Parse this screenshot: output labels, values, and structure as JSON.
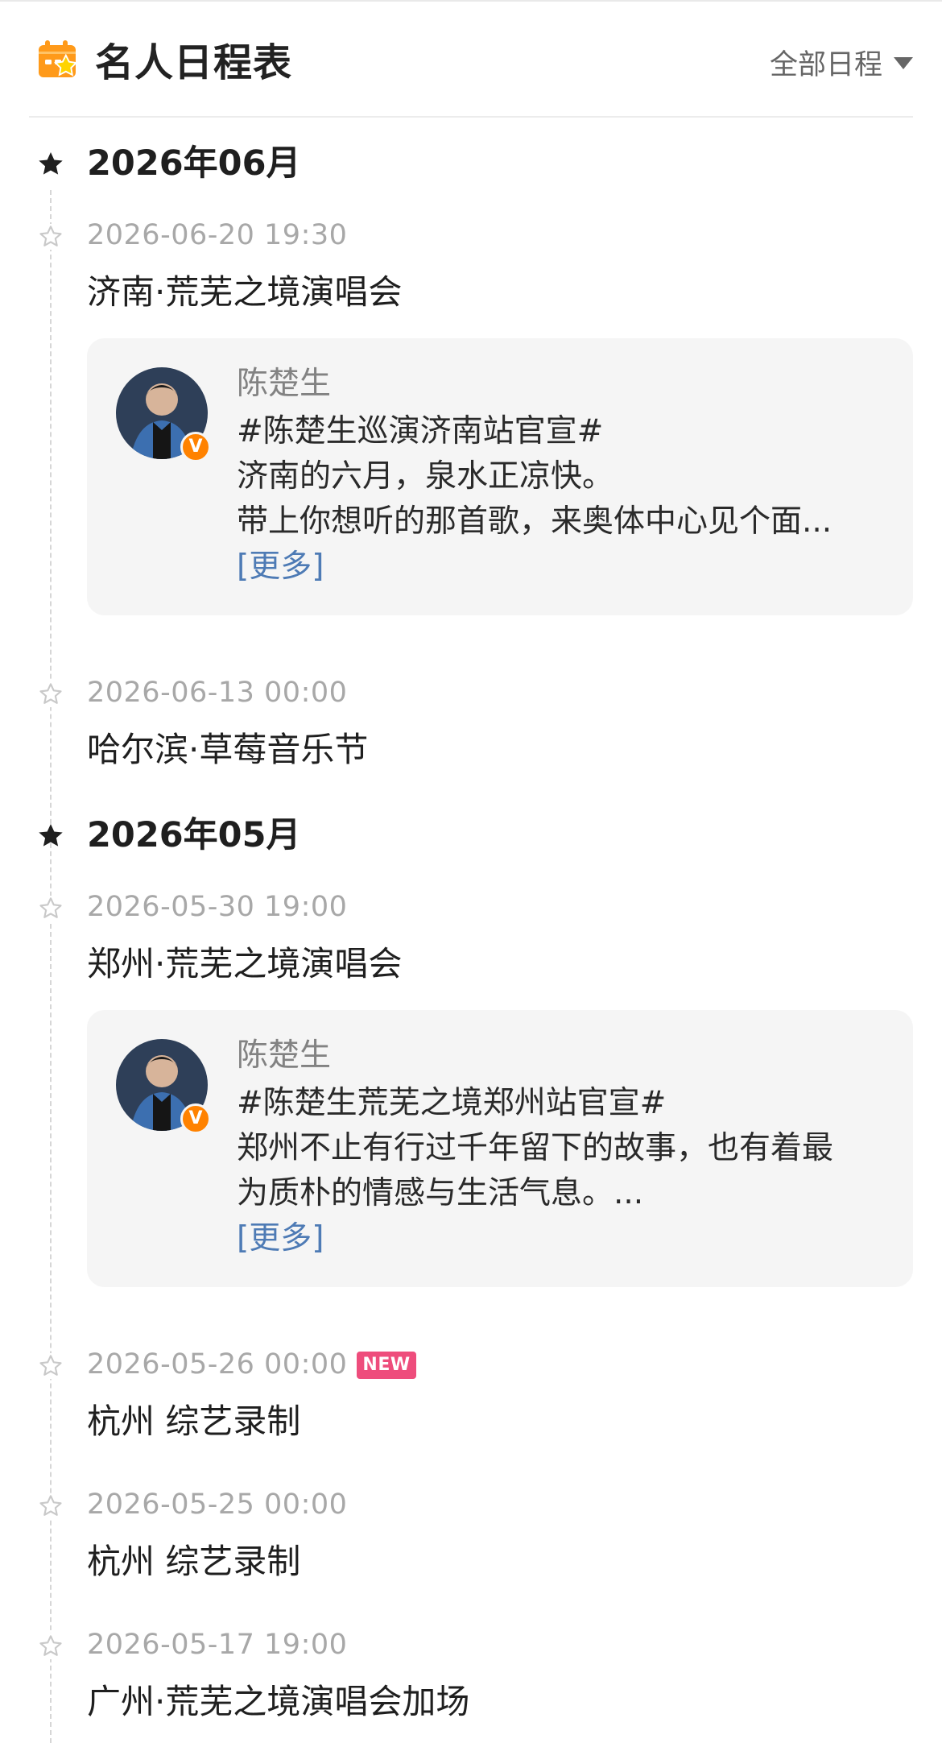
{
  "header": {
    "title": "名人日程表",
    "filter_label": "全部日程",
    "accent_color": "#ff9a1a"
  },
  "months": [
    {
      "label": "2026年06月",
      "events": [
        {
          "datetime": "2026-06-20 19:30",
          "title": "济南·荒芜之境演唱会",
          "post": {
            "author": "陈楚生",
            "lines": [
              "#陈楚生巡演济南站官宣#",
              "济南的六月，泉水正凉快。",
              "带上你想听的那首歌，来奥体中心见个面..."
            ],
            "more_label": "[更多]"
          }
        },
        {
          "datetime": "2026-06-13 00:00",
          "title": "哈尔滨·草莓音乐节"
        }
      ]
    },
    {
      "label": "2026年05月",
      "events": [
        {
          "datetime": "2026-05-30 19:00",
          "title": "郑州·荒芜之境演唱会",
          "post": {
            "author": "陈楚生",
            "lines": [
              "#陈楚生荒芜之境郑州站官宣#",
              "郑州不止有行过千年留下的故事，也有着最",
              "为质朴的情感与生活气息。..."
            ],
            "more_label": "[更多]"
          }
        },
        {
          "datetime": "2026-05-26 00:00",
          "title": "杭州 综艺录制",
          "badge": "NEW"
        },
        {
          "datetime": "2026-05-25 00:00",
          "title": "杭州 综艺录制"
        },
        {
          "datetime": "2026-05-17 19:00",
          "title": "广州·荒芜之境演唱会加场"
        }
      ]
    }
  ],
  "colors": {
    "badge_new": "#ee4d7c",
    "link": "#4e7bb5",
    "verified": "#ff8200",
    "muted_text": "#a8a8a8"
  }
}
